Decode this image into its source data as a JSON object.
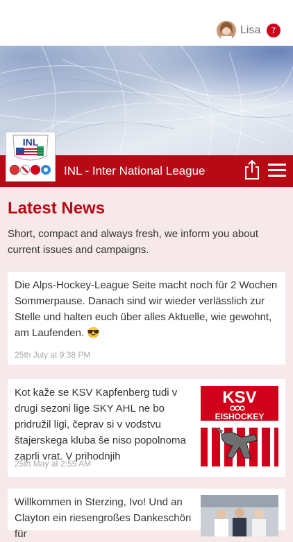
{
  "header": {
    "username": "Lisa",
    "notification_count": "7",
    "avatar_icon": "user-avatar-photo"
  },
  "brand": {
    "logo_text": "INL",
    "title": "INL - Inter National League",
    "accent_color": "#b70a15"
  },
  "toolbar": {
    "share_icon": "share-icon",
    "menu_icon": "hamburger-menu-icon"
  },
  "news": {
    "title": "Latest News",
    "description": "Short, compact and always fresh, we inform you about current issues and campaigns.",
    "items": [
      {
        "text": "Die Alps-Hockey-League Seite macht noch für 2 Wochen Sommerpause. Danach sind wir wieder verlässlich zur Stelle und halten euch über alles Aktuelle, wie gewohnt, am Laufenden. 😎",
        "date": "25th July at 9:38 PM"
      },
      {
        "text": "Kot kaže se KSV Kapfenberg tudi v drugi sezoni lige SKY AHL ne bo pridružil ligi, čeprav si v vodstvu štajerskega kluba še niso popolnoma zaprli vrat. V prihodnjih",
        "date": "25th May at 2:55 AM",
        "image_text_top": "KSV",
        "image_text_side": "EISHOCKEY"
      },
      {
        "text": "Willkommen in Sterzing, Ivo! Und an Clayton ein riesengroßes Dankeschön für",
        "date": ""
      }
    ]
  }
}
